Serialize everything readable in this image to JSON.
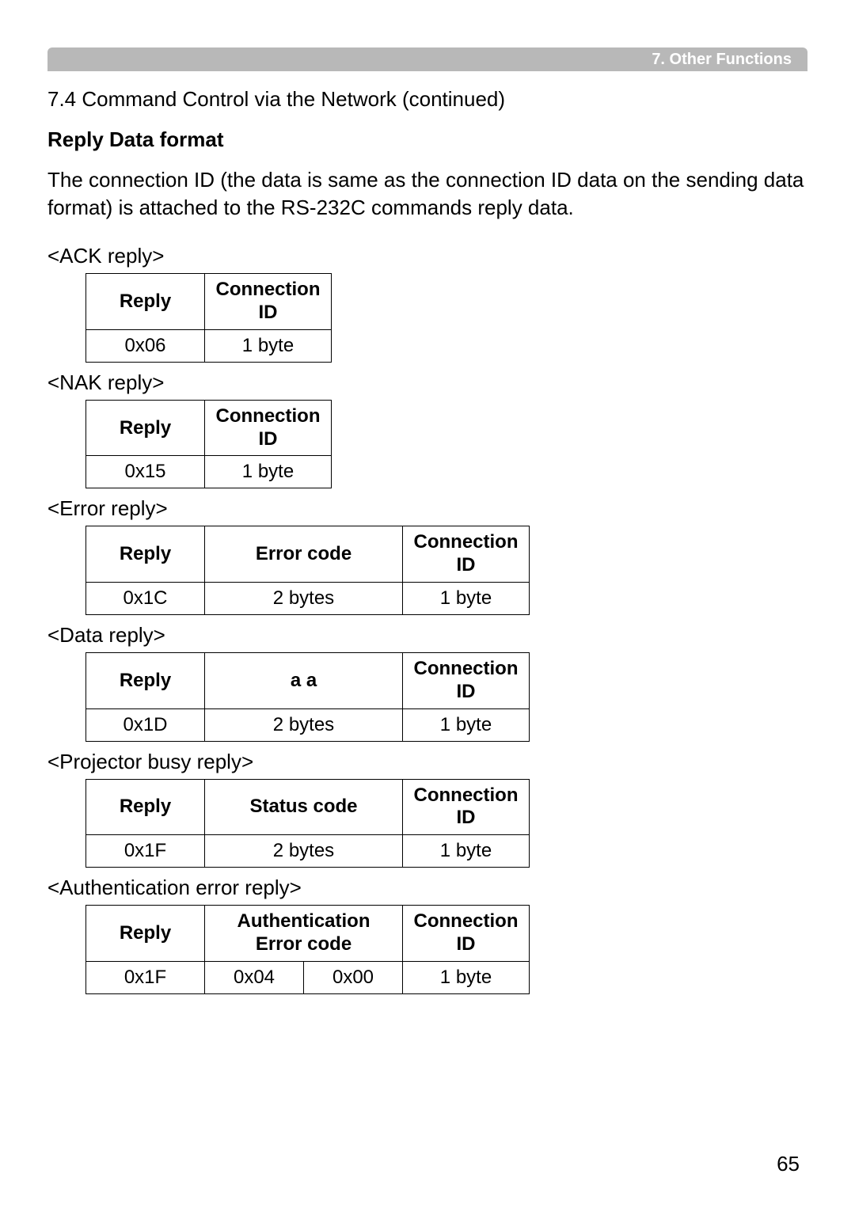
{
  "header": {
    "title": "7. Other Functions"
  },
  "section": {
    "title": "7.4 Command Control via the Network (continued)",
    "subtitle": "Reply Data format",
    "description": "The connection ID (the data is same as the connection ID data on the sending data format) is attached to the RS-232C commands reply data."
  },
  "tables": {
    "ack": {
      "label": "<ACK reply>",
      "headers": {
        "reply": "Reply",
        "conn": "Connection ID"
      },
      "row": {
        "reply": "0x06",
        "conn": "1 byte"
      }
    },
    "nak": {
      "label": "<NAK reply>",
      "headers": {
        "reply": "Reply",
        "conn": "Connection ID"
      },
      "row": {
        "reply": "0x15",
        "conn": "1 byte"
      }
    },
    "error": {
      "label": "<Error reply>",
      "headers": {
        "reply": "Reply",
        "mid": "Error code",
        "conn": "Connection ID"
      },
      "row": {
        "reply": "0x1C",
        "mid": "2 bytes",
        "conn": "1 byte"
      }
    },
    "data": {
      "label": "<Data reply>",
      "headers": {
        "reply": "Reply",
        "mid": "a    a",
        "conn": "Connection ID"
      },
      "row": {
        "reply": "0x1D",
        "mid": "2 bytes",
        "conn": "1 byte"
      }
    },
    "busy": {
      "label": "<Projector busy reply>",
      "headers": {
        "reply": "Reply",
        "mid": "Status code",
        "conn": "Connection ID"
      },
      "row": {
        "reply": "0x1F",
        "mid": "2 bytes",
        "conn": "1 byte"
      }
    },
    "auth": {
      "label": "<Authentication error reply>",
      "headers": {
        "reply": "Reply",
        "mid_line1": "Authentication",
        "mid_line2": "Error code",
        "conn": "Connection ID"
      },
      "row": {
        "reply": "0x1F",
        "mid1": "0x04",
        "mid2": "0x00",
        "conn": "1 byte"
      }
    }
  },
  "page_number": "65"
}
